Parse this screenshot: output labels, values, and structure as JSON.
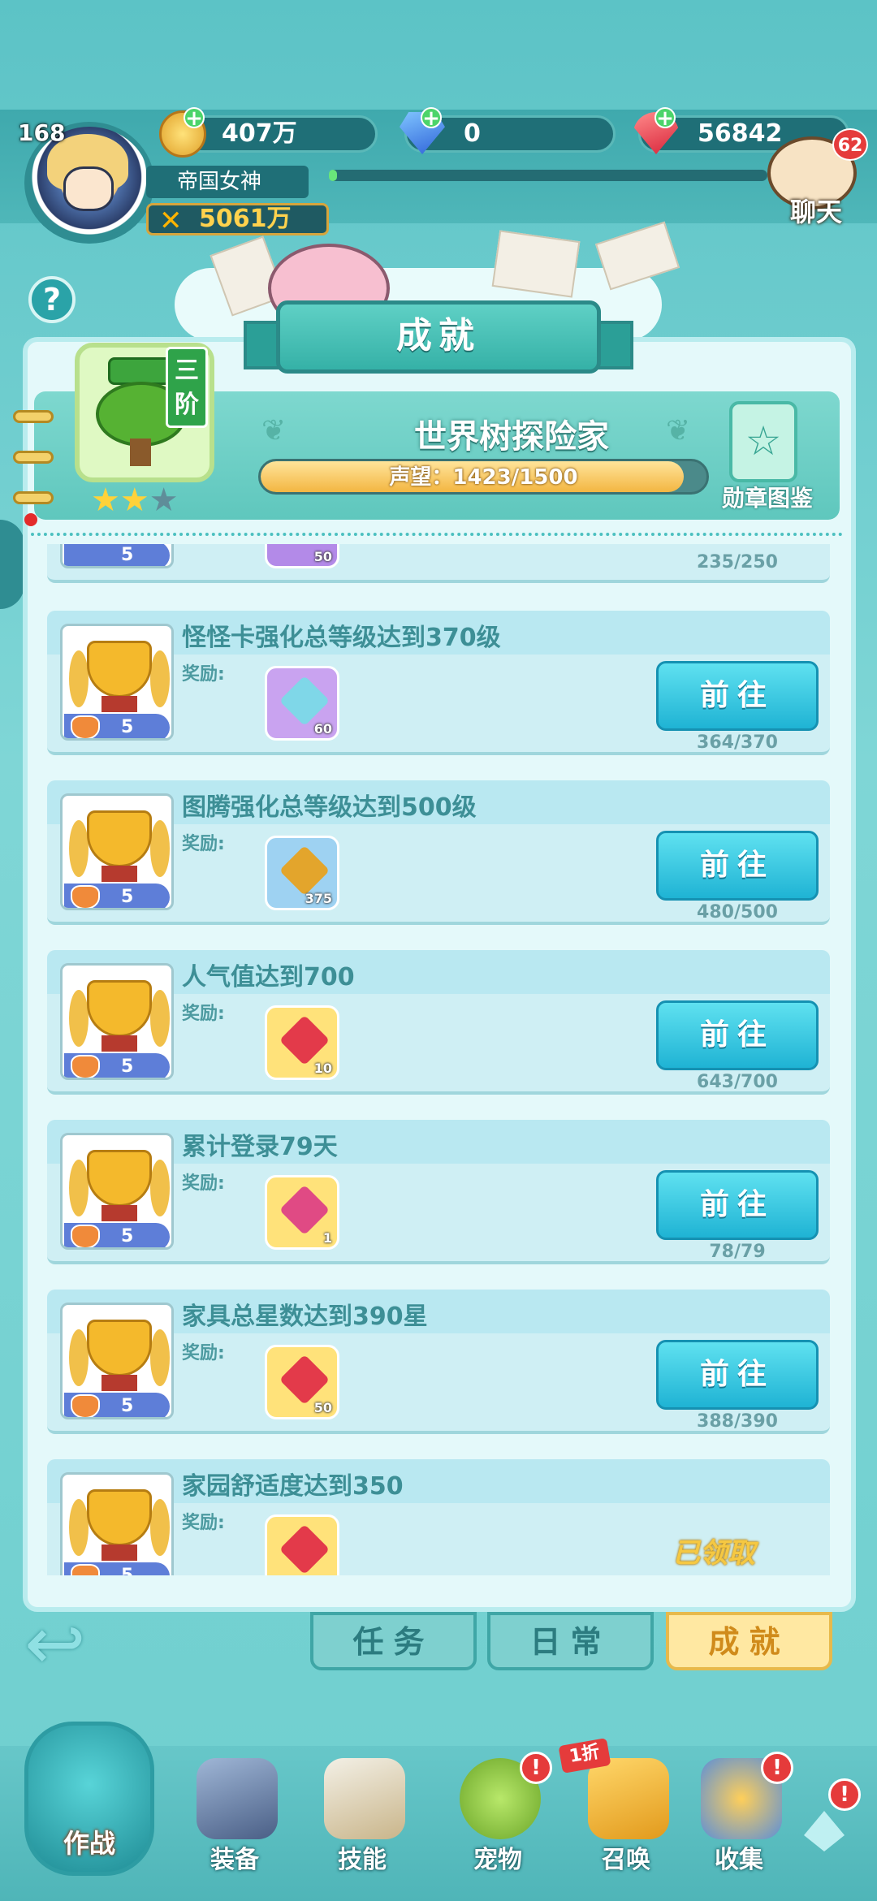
{
  "player": {
    "level": "168",
    "name": "帝国女神",
    "power": "5061万",
    "avatar_icon": "hero-portrait-icon"
  },
  "resources": {
    "gold": "407万",
    "diamond": "0",
    "ruby": "56842"
  },
  "chat": {
    "label": "聊天",
    "badge": "62"
  },
  "help_label": "?",
  "panel": {
    "title": "成就",
    "badge": {
      "tier": "三阶",
      "name": "世界树探险家",
      "prestige_label": "声望：1423/1500",
      "prestige_current": 1423,
      "prestige_max": 1500,
      "stars_filled": 2,
      "stars_total": 3
    },
    "medal_book_label": "勋章图鉴"
  },
  "partial_row": {
    "points": "5",
    "reward_count": "50",
    "progress": "235/250"
  },
  "reward_label": "奖励:",
  "goto_label": "前往",
  "achievements": [
    {
      "title": "怪怪卡强化总等级达到370级",
      "points": "5",
      "reward_icon": "crystal-cluster-icon",
      "reward_bg": "#c9a3f0",
      "reward_color": "#7fd7e8",
      "reward_count": "60",
      "progress": "364/370",
      "status": "goto"
    },
    {
      "title": "图腾强化总等级达到500级",
      "points": "5",
      "reward_icon": "totem-stone-icon",
      "reward_bg": "#9ed2f2",
      "reward_color": "#e3a52c",
      "reward_count": "375",
      "progress": "480/500",
      "status": "goto"
    },
    {
      "title": "人气值达到700",
      "points": "5",
      "reward_icon": "ruby-gem-icon",
      "reward_bg": "#ffe27a",
      "reward_color": "#e33a4a",
      "reward_count": "10",
      "progress": "643/700",
      "status": "goto"
    },
    {
      "title": "累计登录79天",
      "points": "5",
      "reward_icon": "treasure-chest-icon",
      "reward_bg": "#ffe27a",
      "reward_color": "#e04a84",
      "reward_count": "1",
      "progress": "78/79",
      "status": "goto"
    },
    {
      "title": "家具总星数达到390星",
      "points": "5",
      "reward_icon": "ruby-gem-icon",
      "reward_bg": "#ffe27a",
      "reward_color": "#e33a4a",
      "reward_count": "50",
      "progress": "388/390",
      "status": "goto"
    },
    {
      "title": "家园舒适度达到350",
      "points": "5",
      "reward_icon": "ruby-gem-icon",
      "reward_bg": "#ffe27a",
      "reward_color": "#e33a4a",
      "reward_count": "",
      "progress": "",
      "status": "claimed",
      "claimed_label": "已领取"
    }
  ],
  "tabs": [
    {
      "label": "任务",
      "active": false
    },
    {
      "label": "日常",
      "active": false
    },
    {
      "label": "成就",
      "active": true
    }
  ],
  "bottom_nav": [
    {
      "label": "作战",
      "icon": "battle-totem-icon"
    },
    {
      "label": "装备",
      "icon": "cannon-icon"
    },
    {
      "label": "技能",
      "icon": "spellbook-icon"
    },
    {
      "label": "宠物",
      "icon": "pet-slime-icon",
      "alert": "!"
    },
    {
      "label": "召唤",
      "icon": "summon-card-icon",
      "tag": "1折"
    },
    {
      "label": "收集",
      "icon": "collection-compass-icon",
      "alert": "!"
    }
  ],
  "colors": {
    "accent": "#35b1a7",
    "button": "#1fb3d4",
    "active_tab": "#ffe8a2",
    "alert": "#e53b3b"
  }
}
